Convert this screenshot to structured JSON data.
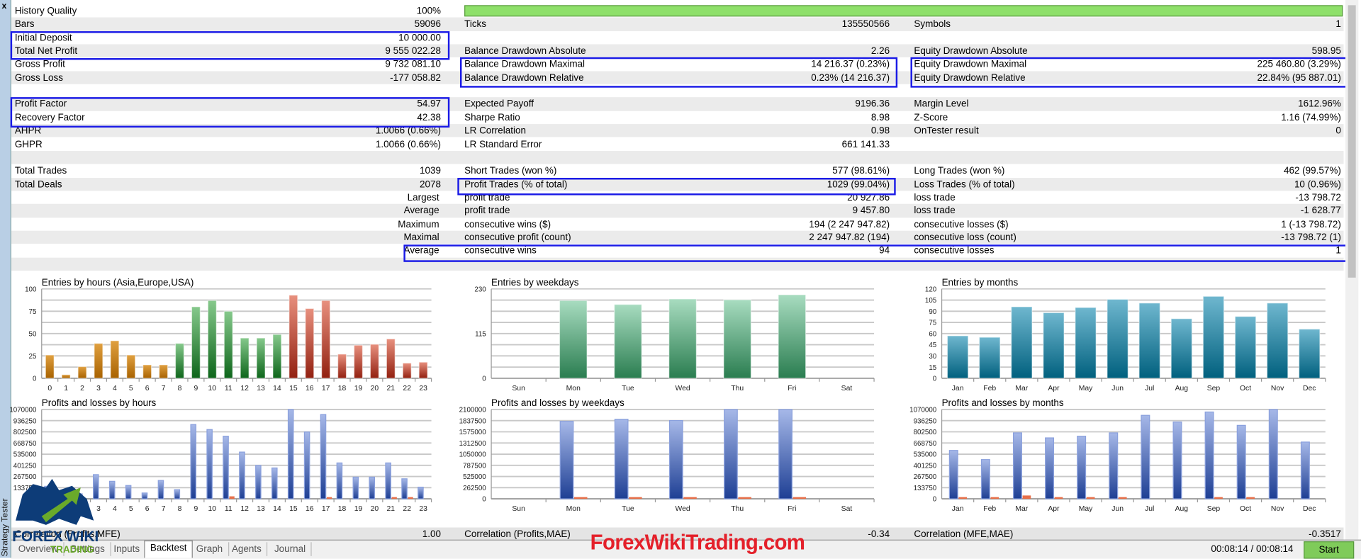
{
  "window": {
    "close_label": "x",
    "panel_title": "Strategy Tester"
  },
  "history_quality_fraction": 1.0,
  "stats_rows": [
    [
      "History Quality",
      "100%",
      "",
      "",
      "",
      ""
    ],
    [
      "Bars",
      "59096",
      "Ticks",
      "135550566",
      "Symbols",
      "1"
    ],
    [
      "Initial Deposit",
      "10 000.00",
      "",
      "",
      "",
      ""
    ],
    [
      "Total Net Profit",
      "9 555 022.28",
      "Balance Drawdown Absolute",
      "2.26",
      "Equity Drawdown Absolute",
      "598.95"
    ],
    [
      "Gross Profit",
      "9 732 081.10",
      "Balance Drawdown Maximal",
      "14 216.37 (0.23%)",
      "Equity Drawdown Maximal",
      "225 460.80 (3.29%)"
    ],
    [
      "Gross Loss",
      "-177 058.82",
      "Balance Drawdown Relative",
      "0.23% (14 216.37)",
      "Equity Drawdown Relative",
      "22.84% (95 887.01)"
    ],
    [
      "",
      "",
      "",
      "",
      "",
      ""
    ],
    [
      "Profit Factor",
      "54.97",
      "Expected Payoff",
      "9196.36",
      "Margin Level",
      "1612.96%"
    ],
    [
      "Recovery Factor",
      "42.38",
      "Sharpe Ratio",
      "8.98",
      "Z-Score",
      "1.16 (74.99%)"
    ],
    [
      "AHPR",
      "1.0066 (0.66%)",
      "LR Correlation",
      "0.98",
      "OnTester result",
      "0"
    ],
    [
      "GHPR",
      "1.0066 (0.66%)",
      "LR Standard Error",
      "661 141.33",
      "",
      ""
    ],
    [
      "",
      "",
      "",
      "",
      "",
      ""
    ],
    [
      "Total Trades",
      "1039",
      "Short Trades (won %)",
      "577 (98.61%)",
      "Long Trades (won %)",
      "462 (99.57%)"
    ],
    [
      "Total Deals",
      "2078",
      "Profit Trades (% of total)",
      "1029 (99.04%)",
      "Loss Trades (% of total)",
      "10 (0.96%)"
    ],
    [
      "Largest",
      "",
      "profit trade",
      "20 927.86",
      "loss trade",
      "-13 798.72"
    ],
    [
      "Average",
      "",
      "profit trade",
      "9 457.80",
      "loss trade",
      "-1 628.77"
    ],
    [
      "Maximum",
      "",
      "consecutive wins ($)",
      "194 (2 247 947.82)",
      "consecutive losses ($)",
      "1 (-13 798.72)"
    ],
    [
      "Maximal",
      "",
      "consecutive profit (count)",
      "2 247 947.82 (194)",
      "consecutive loss (count)",
      "-13 798.72 (1)"
    ],
    [
      "Average",
      "",
      "consecutive wins",
      "94",
      "consecutive losses",
      "1"
    ],
    [
      "",
      "",
      "",
      "",
      "",
      ""
    ]
  ],
  "correlation": {
    "label1": "Correlation (Profits,MFE)",
    "value1": "1.00",
    "label2": "Correlation (Profits,MAE)",
    "value2": "-0.34",
    "label3": "Correlation (MFE,MAE)",
    "value3": "-0.3517"
  },
  "tabs": [
    "Overview",
    "Settings",
    "Inputs",
    "Backtest",
    "Graph",
    "Agents",
    "Journal"
  ],
  "active_tab": "Backtest",
  "status": {
    "time": "00:08:14 / 00:08:14",
    "start_label": "Start"
  },
  "watermark": "ForexWikiTrading.com",
  "logo_text": "FOREX WIKI TRADING",
  "colors": {
    "highlight": "#1a1ae6",
    "progress": "#8ee06a",
    "start": "#7fcb5a",
    "watermark": "#e4202a"
  },
  "chart_data": [
    {
      "type": "bar",
      "id": "entries-hours",
      "title": "Entries by hours (Asia,Europe,USA)",
      "ylim": [
        0,
        100
      ],
      "yticks": [
        "0",
        "",
        "25",
        "",
        "50",
        "",
        "75",
        "",
        "100"
      ],
      "categories": [
        "0",
        "1",
        "2",
        "3",
        "4",
        "5",
        "6",
        "7",
        "8",
        "9",
        "10",
        "11",
        "12",
        "13",
        "14",
        "15",
        "16",
        "17",
        "18",
        "19",
        "20",
        "21",
        "22",
        "23"
      ],
      "values": [
        26,
        4,
        13,
        39,
        42,
        26,
        15,
        15,
        39,
        80,
        87,
        75,
        45,
        45,
        49,
        93,
        78,
        87,
        27,
        37,
        38,
        44,
        17,
        18
      ],
      "groups": [
        "asia",
        "asia",
        "asia",
        "asia",
        "asia",
        "asia",
        "asia",
        "asia",
        "europe",
        "europe",
        "europe",
        "europe",
        "europe",
        "europe",
        "europe",
        "usa",
        "usa",
        "usa",
        "usa",
        "usa",
        "usa",
        "usa",
        "usa",
        "usa"
      ]
    },
    {
      "type": "bar",
      "id": "entries-weekdays",
      "title": "Entries by weekdays",
      "ylim": [
        0,
        230
      ],
      "yticks": [
        "0",
        "",
        "",
        "",
        "115",
        "",
        "",
        "",
        "230"
      ],
      "categories": [
        "Sun",
        "Mon",
        "Tue",
        "Wed",
        "Thu",
        "Fri",
        "Sat"
      ],
      "values": [
        0,
        200,
        190,
        204,
        202,
        215,
        0
      ]
    },
    {
      "type": "bar",
      "id": "entries-months",
      "title": "Entries by months",
      "ylim": [
        0,
        120
      ],
      "yticks": [
        "0",
        "15",
        "30",
        "45",
        "60",
        "75",
        "90",
        "105",
        "120"
      ],
      "categories": [
        "Jan",
        "Feb",
        "Mar",
        "Apr",
        "May",
        "Jun",
        "Jul",
        "Aug",
        "Sep",
        "Oct",
        "Nov",
        "Dec"
      ],
      "values": [
        57,
        55,
        96,
        88,
        95,
        106,
        101,
        80,
        110,
        83,
        101,
        66
      ]
    },
    {
      "type": "bar",
      "id": "pnl-hours",
      "title": "Profits and losses by hours",
      "ylim": [
        0,
        1070000
      ],
      "yticks": [
        "0",
        "133750",
        "267500",
        "401250",
        "535000",
        "668750",
        "802500",
        "936250",
        "1070000"
      ],
      "categories": [
        "0",
        "1",
        "2",
        "3",
        "4",
        "5",
        "6",
        "7",
        "8",
        "9",
        "10",
        "11",
        "12",
        "13",
        "14",
        "15",
        "16",
        "17",
        "18",
        "19",
        "20",
        "21",
        "22",
        "23"
      ],
      "series": [
        {
          "name": "profits",
          "values": [
            150000,
            80000,
            60000,
            290000,
            210000,
            160000,
            70000,
            220000,
            110000,
            890000,
            830000,
            750000,
            560000,
            400000,
            370000,
            1070000,
            800000,
            1010000,
            430000,
            260000,
            260000,
            430000,
            240000,
            140000
          ]
        },
        {
          "name": "losses",
          "values": [
            0,
            0,
            0,
            0,
            0,
            0,
            0,
            0,
            0,
            0,
            0,
            30000,
            0,
            0,
            0,
            0,
            0,
            10000,
            0,
            0,
            0,
            8000,
            8000,
            0
          ]
        }
      ]
    },
    {
      "type": "bar",
      "id": "pnl-weekdays",
      "title": "Profits and losses by weekdays",
      "ylim": [
        0,
        2100000
      ],
      "yticks": [
        "0",
        "262500",
        "525000",
        "787500",
        "1050000",
        "1312500",
        "1575000",
        "1837500",
        "2100000"
      ],
      "categories": [
        "Sun",
        "Mon",
        "Tue",
        "Wed",
        "Thu",
        "Fri",
        "Sat"
      ],
      "series": [
        {
          "name": "profits",
          "values": [
            0,
            1820000,
            1870000,
            1840000,
            2100000,
            2100000,
            0
          ]
        },
        {
          "name": "losses",
          "values": [
            0,
            30000,
            15000,
            15000,
            15000,
            15000,
            0
          ]
        }
      ]
    },
    {
      "type": "bar",
      "id": "pnl-months",
      "title": "Profits and losses by months",
      "ylim": [
        0,
        1070000
      ],
      "yticks": [
        "0",
        "133750",
        "267500",
        "401250",
        "535000",
        "668750",
        "802500",
        "936250",
        "1070000"
      ],
      "categories": [
        "Jan",
        "Feb",
        "Mar",
        "Apr",
        "May",
        "Jun",
        "Jul",
        "Aug",
        "Sep",
        "Oct",
        "Nov",
        "Dec"
      ],
      "series": [
        {
          "name": "profits",
          "values": [
            580000,
            470000,
            790000,
            730000,
            750000,
            790000,
            1000000,
            920000,
            1040000,
            880000,
            1070000,
            680000
          ]
        },
        {
          "name": "losses",
          "values": [
            8000,
            8000,
            40000,
            8000,
            8000,
            8000,
            0,
            0,
            8000,
            8000,
            0,
            0
          ]
        }
      ]
    }
  ]
}
